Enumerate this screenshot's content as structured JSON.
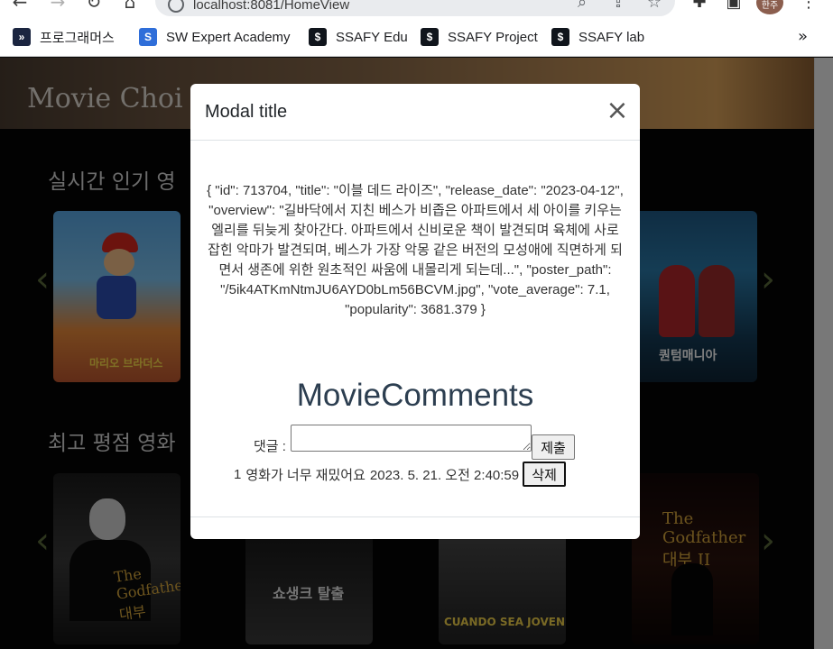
{
  "browser": {
    "url": "localhost:8081/HomeView",
    "profile_initials": "한주",
    "bookmarks": [
      {
        "label": "프로그래머스",
        "icon": "programmers-icon"
      },
      {
        "label": "SW Expert Academy",
        "icon": "swea-icon"
      },
      {
        "label": "SSAFY Edu",
        "icon": "ssafy-icon"
      },
      {
        "label": "SSAFY Project",
        "icon": "ssafy-icon"
      },
      {
        "label": "SSAFY lab",
        "icon": "ssafy-icon"
      }
    ],
    "bookmarks_more": "»"
  },
  "page": {
    "brand": "Movie Choi",
    "sections": [
      {
        "title": "실시간 인기 영"
      },
      {
        "title": "최고 평점 영화"
      }
    ],
    "poster_text": {
      "mario": "마리오 브라더스",
      "antman": "퀀텀매니아",
      "godfather": "The Godfather 대부",
      "shawshank": "쇼생크 탈출",
      "joven": "CUANDO SEA JOVEN",
      "godfather2": "The Godfather 대부 II"
    }
  },
  "modal": {
    "title": "Modal title",
    "movie_json": "{ \"id\": 713704, \"title\": \"이블 데드 라이즈\", \"release_date\": \"2023-04-12\", \"overview\": \"길바닥에서 지친 베스가 비좁은 아파트에서 세 아이를 키우는 엘리를 뒤늦게 찾아간다. 아파트에서 신비로운 책이 발견되며 육체에 사로잡힌 악마가 발견되며, 베스가 가장 악몽 같은 버전의 모성애에 직면하게 되면서 생존에 위한 원초적인 싸움에 내몰리게 되는데...\", \"poster_path\": \"/5ik4ATKmNtmJU6AYD0bLm56BCVM.jpg\", \"vote_average\": 7.1, \"popularity\": 3681.379 }",
    "comments_title": "MovieComments",
    "comment_label": "댓글 :",
    "comment_input_value": "",
    "submit_label": "제출",
    "comments": [
      {
        "id": "1",
        "text": "영화가 너무 재밌어요",
        "timestamp": "2023. 5. 21. 오전 2:40:59",
        "delete_label": "삭제"
      }
    ]
  },
  "colors": {
    "overlay": "rgba(0,0,0,0.5)",
    "modal_bg": "#ffffff",
    "heading": "#2c3e50"
  }
}
